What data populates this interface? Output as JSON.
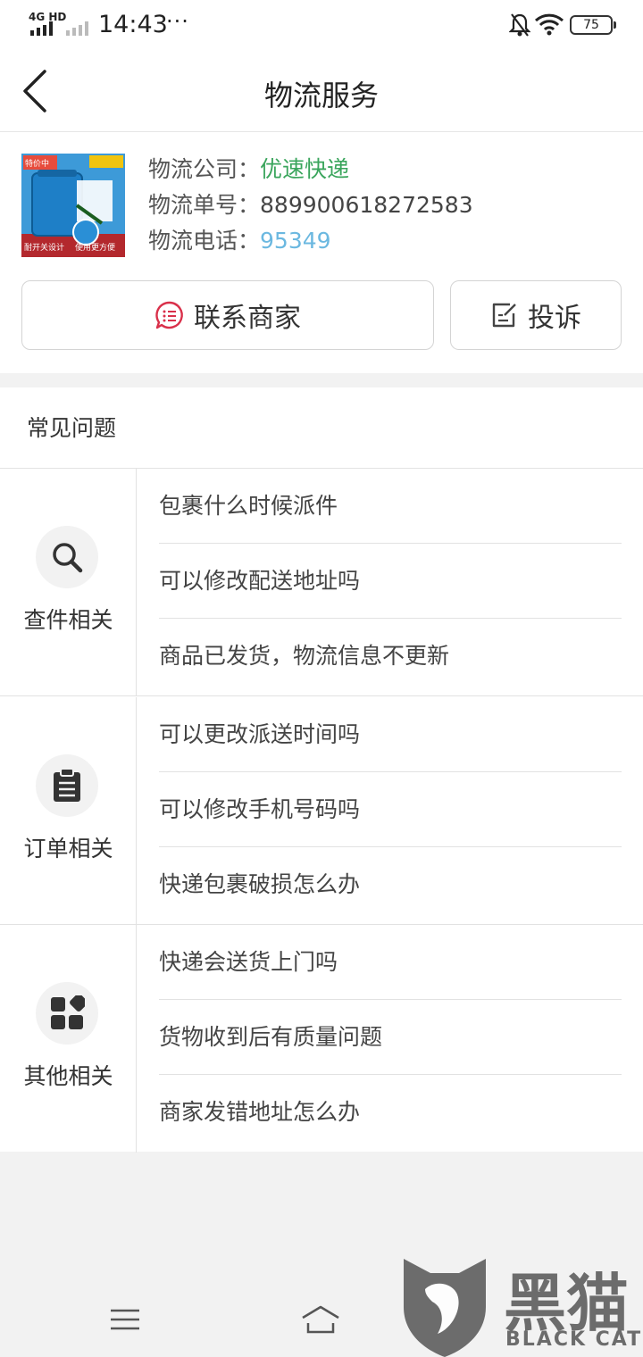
{
  "status_bar": {
    "network": "4G HD",
    "time": "14:43",
    "dots": "···",
    "battery": "75"
  },
  "nav": {
    "title": "物流服务"
  },
  "logistics": {
    "company_label": "物流公司：",
    "company_value": "优速快递",
    "number_label": "物流单号：",
    "number_value": "889900618272583",
    "phone_label": "物流电话：",
    "phone_value": "95349",
    "company_color": "#3aa55c",
    "phone_color": "#6bb8e0"
  },
  "actions": {
    "contact_label": "联系商家",
    "complain_label": "投诉"
  },
  "faq": {
    "header": "常见问题",
    "groups": [
      {
        "label": "查件相关",
        "icon": "search-icon",
        "questions": [
          "包裹什么时候派件",
          "可以修改配送地址吗",
          "商品已发货，物流信息不更新"
        ]
      },
      {
        "label": "订单相关",
        "icon": "clipboard-icon",
        "questions": [
          "可以更改派送时间吗",
          "可以修改手机号码吗",
          "快递包裹破损怎么办"
        ]
      },
      {
        "label": "其他相关",
        "icon": "grid-icon",
        "questions": [
          "快递会送货上门吗",
          "货物收到后有质量问题",
          "商家发错地址怎么办"
        ]
      }
    ]
  },
  "product_image": {
    "tag_top": "特价中",
    "tag_bottom": "耐开关设计",
    "tag_right": "使用更方便"
  },
  "watermark": {
    "text": "黑猫",
    "sub": "BLACK CAT"
  }
}
